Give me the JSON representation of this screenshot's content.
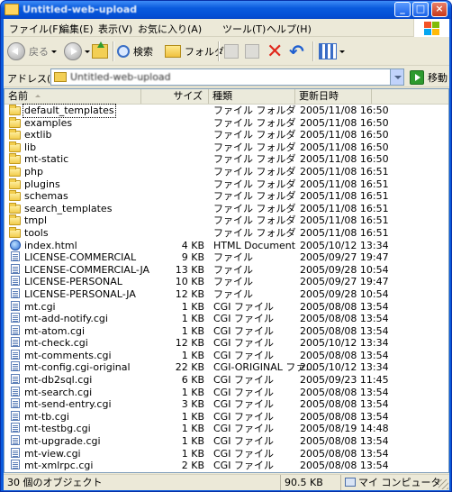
{
  "window": {
    "title": "Untitled-web-upload"
  },
  "menu": [
    "ファイル(F)",
    "編集(E)",
    "表示(V)",
    "お気に入り(A)",
    "ツール(T)",
    "ヘルプ(H)"
  ],
  "toolbar": {
    "back_label": "戻る",
    "search_label": "検索",
    "folders_label": "フォルダ"
  },
  "address": {
    "label": "アドレス(D)",
    "value": "Untitled-web-upload",
    "go_label": "移動"
  },
  "columns": {
    "name": "名前",
    "size": "サイズ",
    "type": "種類",
    "date": "更新日時"
  },
  "files": [
    {
      "name": "default_templates",
      "size": "",
      "type": "ファイル フォルダ",
      "date": "2005/11/08 16:50",
      "icon": "folder"
    },
    {
      "name": "examples",
      "size": "",
      "type": "ファイル フォルダ",
      "date": "2005/11/08 16:50",
      "icon": "folder"
    },
    {
      "name": "extlib",
      "size": "",
      "type": "ファイル フォルダ",
      "date": "2005/11/08 16:50",
      "icon": "folder"
    },
    {
      "name": "lib",
      "size": "",
      "type": "ファイル フォルダ",
      "date": "2005/11/08 16:50",
      "icon": "folder"
    },
    {
      "name": "mt-static",
      "size": "",
      "type": "ファイル フォルダ",
      "date": "2005/11/08 16:50",
      "icon": "folder"
    },
    {
      "name": "php",
      "size": "",
      "type": "ファイル フォルダ",
      "date": "2005/11/08 16:51",
      "icon": "folder"
    },
    {
      "name": "plugins",
      "size": "",
      "type": "ファイル フォルダ",
      "date": "2005/11/08 16:51",
      "icon": "folder"
    },
    {
      "name": "schemas",
      "size": "",
      "type": "ファイル フォルダ",
      "date": "2005/11/08 16:51",
      "icon": "folder"
    },
    {
      "name": "search_templates",
      "size": "",
      "type": "ファイル フォルダ",
      "date": "2005/11/08 16:51",
      "icon": "folder"
    },
    {
      "name": "tmpl",
      "size": "",
      "type": "ファイル フォルダ",
      "date": "2005/11/08 16:51",
      "icon": "folder"
    },
    {
      "name": "tools",
      "size": "",
      "type": "ファイル フォルダ",
      "date": "2005/11/08 16:51",
      "icon": "folder"
    },
    {
      "name": "index.html",
      "size": "4 KB",
      "type": "HTML Document",
      "date": "2005/10/12 13:34",
      "icon": "html"
    },
    {
      "name": "LICENSE-COMMERCIAL",
      "size": "9 KB",
      "type": "ファイル",
      "date": "2005/09/27 19:47",
      "icon": "file"
    },
    {
      "name": "LICENSE-COMMERCIAL-JA",
      "size": "13 KB",
      "type": "ファイル",
      "date": "2005/09/28 10:54",
      "icon": "file"
    },
    {
      "name": "LICENSE-PERSONAL",
      "size": "10 KB",
      "type": "ファイル",
      "date": "2005/09/27 19:47",
      "icon": "file"
    },
    {
      "name": "LICENSE-PERSONAL-JA",
      "size": "12 KB",
      "type": "ファイル",
      "date": "2005/09/28 10:54",
      "icon": "file"
    },
    {
      "name": "mt.cgi",
      "size": "1 KB",
      "type": "CGI ファイル",
      "date": "2005/08/08 13:54",
      "icon": "file"
    },
    {
      "name": "mt-add-notify.cgi",
      "size": "1 KB",
      "type": "CGI ファイル",
      "date": "2005/08/08 13:54",
      "icon": "file"
    },
    {
      "name": "mt-atom.cgi",
      "size": "1 KB",
      "type": "CGI ファイル",
      "date": "2005/08/08 13:54",
      "icon": "file"
    },
    {
      "name": "mt-check.cgi",
      "size": "12 KB",
      "type": "CGI ファイル",
      "date": "2005/10/12 13:34",
      "icon": "file"
    },
    {
      "name": "mt-comments.cgi",
      "size": "1 KB",
      "type": "CGI ファイル",
      "date": "2005/08/08 13:54",
      "icon": "file"
    },
    {
      "name": "mt-config.cgi-original",
      "size": "22 KB",
      "type": "CGI-ORIGINAL ファ...",
      "date": "2005/10/12 13:34",
      "icon": "file"
    },
    {
      "name": "mt-db2sql.cgi",
      "size": "6 KB",
      "type": "CGI ファイル",
      "date": "2005/09/23 11:45",
      "icon": "file"
    },
    {
      "name": "mt-search.cgi",
      "size": "1 KB",
      "type": "CGI ファイル",
      "date": "2005/08/08 13:54",
      "icon": "file"
    },
    {
      "name": "mt-send-entry.cgi",
      "size": "3 KB",
      "type": "CGI ファイル",
      "date": "2005/08/08 13:54",
      "icon": "file"
    },
    {
      "name": "mt-tb.cgi",
      "size": "1 KB",
      "type": "CGI ファイル",
      "date": "2005/08/08 13:54",
      "icon": "file"
    },
    {
      "name": "mt-testbg.cgi",
      "size": "1 KB",
      "type": "CGI ファイル",
      "date": "2005/08/19 14:48",
      "icon": "file"
    },
    {
      "name": "mt-upgrade.cgi",
      "size": "1 KB",
      "type": "CGI ファイル",
      "date": "2005/08/08 13:54",
      "icon": "file"
    },
    {
      "name": "mt-view.cgi",
      "size": "1 KB",
      "type": "CGI ファイル",
      "date": "2005/08/08 13:54",
      "icon": "file"
    },
    {
      "name": "mt-xmlrpc.cgi",
      "size": "2 KB",
      "type": "CGI ファイル",
      "date": "2005/08/08 13:54",
      "icon": "file"
    }
  ],
  "status": {
    "count": "30 個のオブジェクト",
    "size": "90.5 KB",
    "location": "マイ コンピュータ"
  }
}
